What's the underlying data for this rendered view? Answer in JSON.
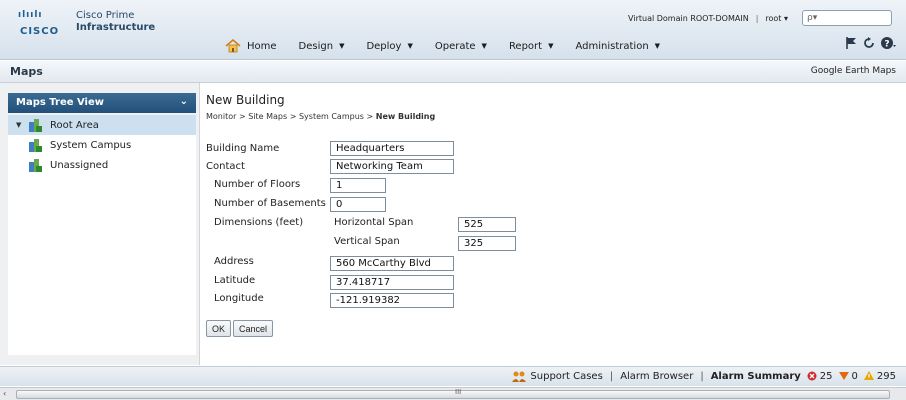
{
  "brand": {
    "logo_dots": "ılıılı",
    "logo_word": "CISCO",
    "product_line1": "Cisco Prime",
    "product_line2": "Infrastructure"
  },
  "topbar": {
    "domain": "Virtual Domain ROOT-DOMAIN",
    "separator": "|",
    "user": "root ▾",
    "search_glyph": "ρ▾"
  },
  "nav": {
    "home": "Home",
    "items": [
      {
        "label": "Design"
      },
      {
        "label": "Deploy"
      },
      {
        "label": "Operate"
      },
      {
        "label": "Report"
      },
      {
        "label": "Administration"
      }
    ],
    "caret": "▼"
  },
  "titlebar": {
    "title": "Maps",
    "right_link": "Google Earth Maps"
  },
  "tree": {
    "header": "Maps Tree View",
    "chevron": "⌄",
    "items": [
      {
        "label": "Root Area",
        "selected": true,
        "expanded": true
      },
      {
        "label": "System Campus"
      },
      {
        "label": "Unassigned"
      }
    ]
  },
  "form": {
    "title": "New Building",
    "breadcrumb": {
      "p1": "Monitor",
      "p2": "Site Maps",
      "p3": "System Campus",
      "current": "New Building",
      "sep": ">"
    },
    "building_name": {
      "label": "Building Name",
      "value": "Headquarters"
    },
    "contact": {
      "label": "Contact",
      "value": "Networking Team"
    },
    "floors": {
      "label": "Number of Floors",
      "value": "1"
    },
    "basements": {
      "label": "Number of Basements",
      "value": "0"
    },
    "dimensions": {
      "label": "Dimensions (feet)",
      "h_label": "Horizontal Span",
      "h_value": "525",
      "v_label": "Vertical Span",
      "v_value": "325"
    },
    "address": {
      "label": "Address",
      "value": "560 McCarthy Blvd"
    },
    "latitude": {
      "label": "Latitude",
      "value": "37.418717"
    },
    "longitude": {
      "label": "Longitude",
      "value": "-121.919382"
    },
    "ok": "OK",
    "cancel": "Cancel"
  },
  "footer": {
    "support": "Support Cases",
    "alarm_browser": "Alarm Browser",
    "alarm_summary": "Alarm Summary",
    "sep": "|",
    "critical": "25",
    "major": "0",
    "minor": "295",
    "colors": {
      "critical": "#d22b2b",
      "major": "#e06a10",
      "minor": "#e8a800"
    }
  },
  "scroll": {
    "left_arrow": "‹",
    "grip": "III"
  }
}
